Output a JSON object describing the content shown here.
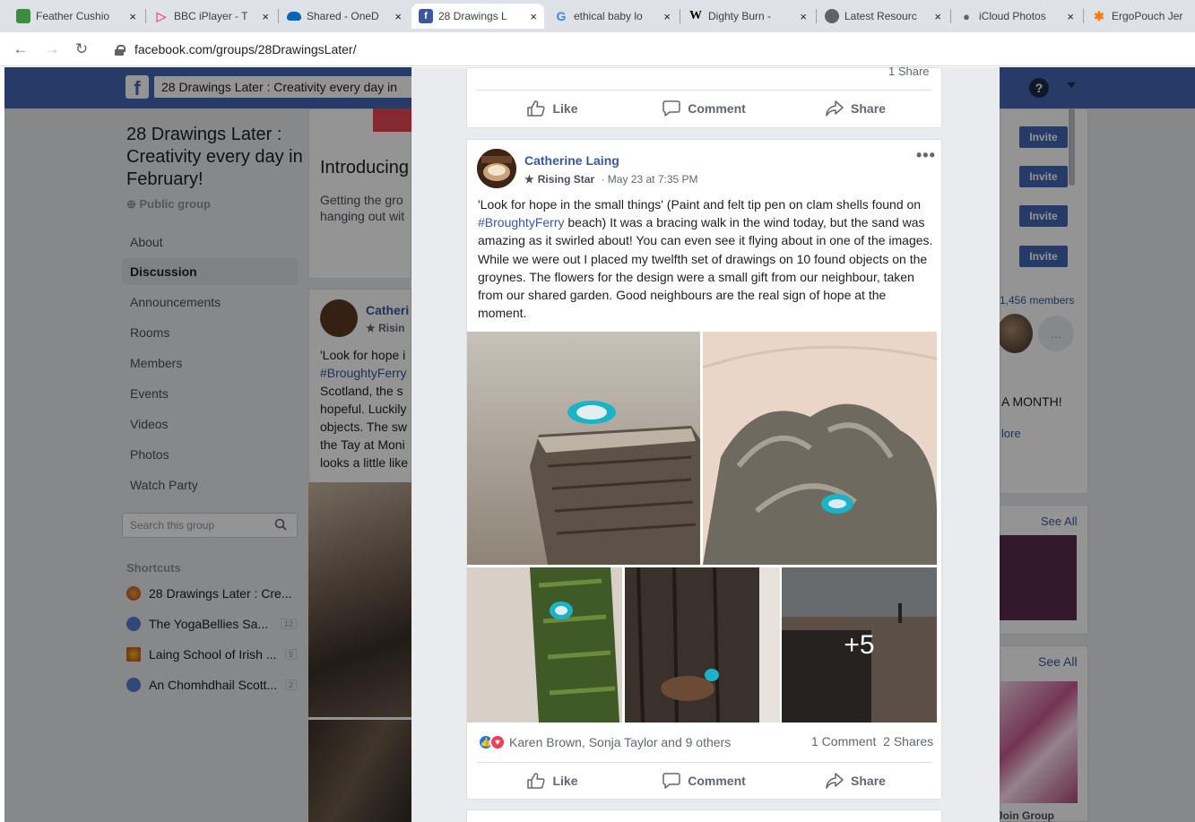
{
  "browser": {
    "tabs": [
      {
        "title": "Feather Cushio",
        "color": "#3d8c40"
      },
      {
        "title": "BBC iPlayer - T",
        "color": "#f54997"
      },
      {
        "title": "Shared - OneD",
        "color": "#0364b8"
      },
      {
        "title": "28 Drawings L",
        "color": "#3b5998",
        "active": true
      },
      {
        "title": "ethical baby lo",
        "color": "#4285f4"
      },
      {
        "title": "Dighty Burn -",
        "color": "#000000"
      },
      {
        "title": "Latest Resourc",
        "color": "#5f6368"
      },
      {
        "title": "iCloud Photos",
        "color": "#5f6368"
      },
      {
        "title": "ErgoPouch Jer",
        "color": "#f57c00"
      }
    ],
    "close_glyph": "×",
    "url": "facebook.com/groups/28DrawingsLater/"
  },
  "fb": {
    "logo": "f",
    "search_value": "28 Drawings Later : Creativity every day in",
    "help": "?"
  },
  "group": {
    "title": "28 Drawings Later : Creativity every day in February!",
    "privacy": "Public group",
    "nav": [
      "About",
      "Discussion",
      "Announcements",
      "Rooms",
      "Members",
      "Events",
      "Videos",
      "Photos",
      "Watch Party"
    ],
    "search_placeholder": "Search this group",
    "shortcuts_heading": "Shortcuts",
    "shortcuts": [
      {
        "label": "28 Drawings Later : Cre...",
        "count": ""
      },
      {
        "label": "The YogaBellies Sa...",
        "count": "12"
      },
      {
        "label": "Laing School of Irish ...",
        "count": "9"
      },
      {
        "label": "An Chomhdhail Scott...",
        "count": "2"
      }
    ]
  },
  "middle": {
    "intro_heading": "Introducing",
    "intro_text_1": "Getting the gro",
    "intro_text_2": "hanging out wit",
    "name": "Catheri",
    "star": "Risin",
    "text_lines": [
      "'Look for hope i",
      "#BroughtyFerry",
      "Scotland, the s",
      "hopeful. Luckily",
      "objects. The sw",
      "the Tay at Moni",
      "looks a little like"
    ]
  },
  "right": {
    "invite_label": "Invite",
    "members": "1,456 members",
    "more_avatar": "...",
    "a_month": "A MONTH!",
    "more": "lore",
    "see_all_1": "See All",
    "see_all_2": "See All",
    "join_group": "Join Group"
  },
  "post_prev": {
    "shares": "1 Share"
  },
  "post": {
    "author": "Catherine Laing",
    "badge": "Rising Star",
    "date": "May 23 at 7:35 PM",
    "dots": "•••",
    "text_before": "'Look for hope in the small things' (Paint and felt tip pen on clam shells found on ",
    "hashtag": "#BroughtyFerry",
    "text_after": " beach) It was a bracing walk in the wind today, but the sand was amazing as it swirled about! You can even see it flying about in one of the images. While we were out I placed my twelfth set of drawings on 10 found objects on the groynes. The flowers for the design were a small gift from our neighbour, taken from our shared garden. Good neighbours are the real sign of hope at the moment.",
    "more_photos": "+5",
    "reactions_text": "Karen Brown, Sonja Taylor and 9 others",
    "counts": "1 Comment  2 Shares"
  },
  "actions": {
    "like": "Like",
    "comment": "Comment",
    "share": "Share"
  }
}
